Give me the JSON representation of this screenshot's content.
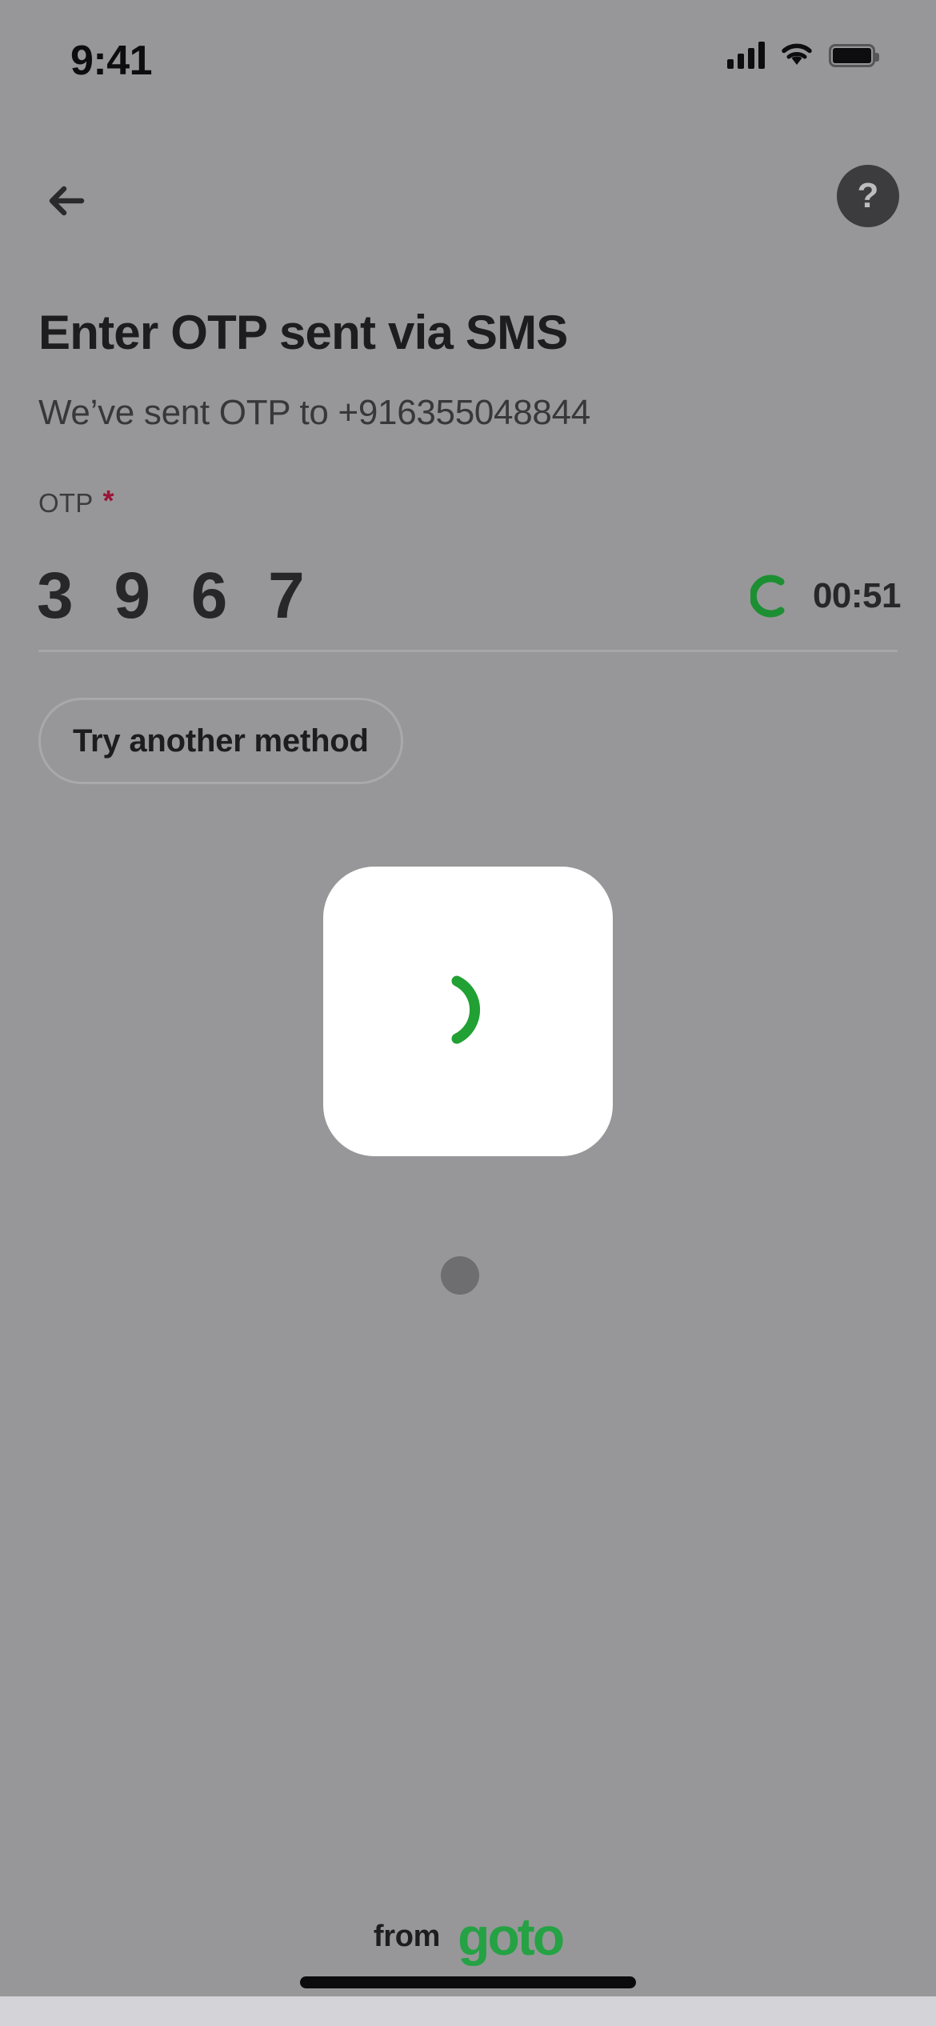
{
  "status_bar": {
    "time": "9:41",
    "cellular_icon": "cellular-signal-icon",
    "wifi_icon": "wifi-icon",
    "battery_icon": "battery-full-icon"
  },
  "nav": {
    "back_icon": "back-arrow-icon",
    "help_label": "?",
    "help_icon": "help-question-icon"
  },
  "content": {
    "title": "Enter OTP sent via SMS",
    "subtitle": "We’ve sent OTP to +916355048844",
    "otp_label": "OTP",
    "required_marker": "*",
    "otp_value": "3 9 6 7",
    "timer": "00:51",
    "timer_spinner_icon": "resend-spinner-icon",
    "try_another_method_label": "Try another method"
  },
  "overlay": {
    "loading_spinner_icon": "loading-spinner-icon",
    "page_indicator_icon": "page-indicator-dot"
  },
  "footer": {
    "from_label": "from",
    "brand": "goto"
  },
  "colors": {
    "background": "#979799",
    "accent_green": "#25a244",
    "required_red": "#9b1437",
    "text_primary": "#1d1d1f",
    "card_white": "#ffffff",
    "help_button": "#3c3c3e"
  }
}
